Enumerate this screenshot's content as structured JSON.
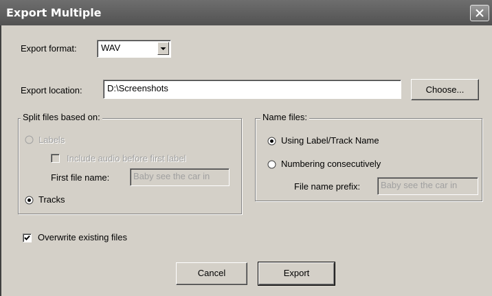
{
  "window": {
    "title": "Export Multiple"
  },
  "format": {
    "label": "Export format:",
    "value": "WAV"
  },
  "location": {
    "label": "Export location:",
    "value": "D:\\Screenshots",
    "choose_label": "Choose..."
  },
  "split": {
    "legend": "Split files based on:",
    "labels_option": "Labels",
    "include_audio": "Include audio before first label",
    "first_file_label": "First file name:",
    "first_file_value": "Baby see the car in",
    "tracks_option": "Tracks",
    "selected": "Tracks"
  },
  "name_files": {
    "legend": "Name files:",
    "using_label": "Using Label/Track Name",
    "numbering": "Numbering consecutively",
    "prefix_label": "File name prefix:",
    "prefix_value": "Baby see the car in",
    "selected": "Using Label/Track Name"
  },
  "overwrite": {
    "label": "Overwrite existing files",
    "checked": true
  },
  "buttons": {
    "cancel": "Cancel",
    "export": "Export"
  },
  "icons": {
    "close": "close-icon",
    "dropdown": "chevron-down-icon"
  }
}
